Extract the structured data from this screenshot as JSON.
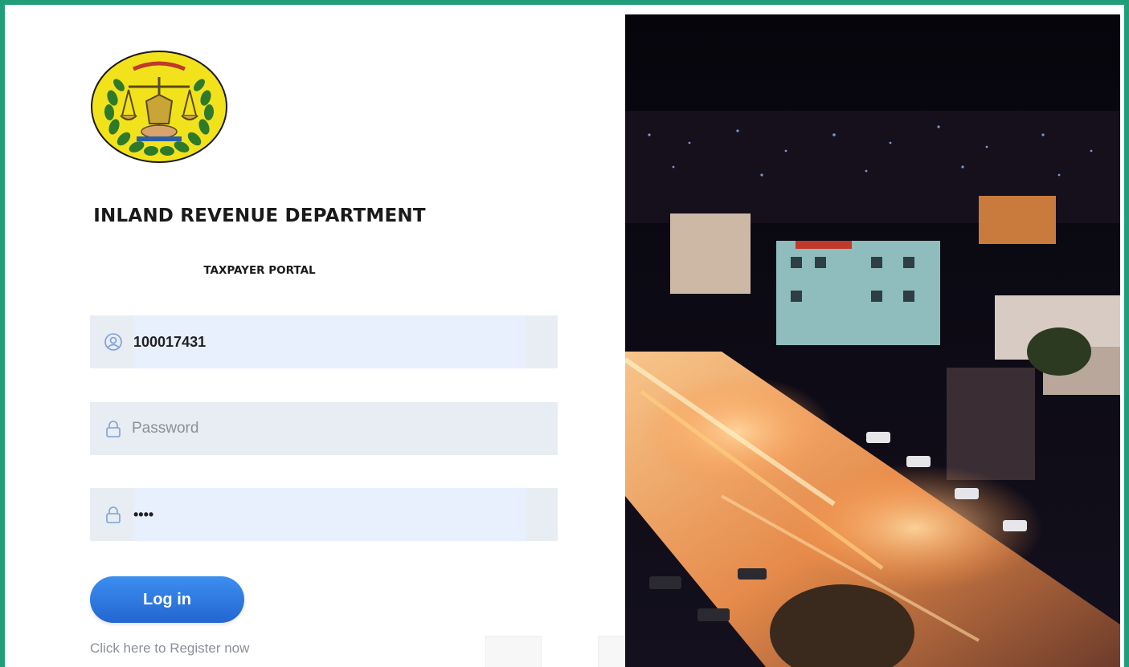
{
  "header": {
    "organization": "INLAND REVENUE DEPARTMENT",
    "portal": "TAXPAYER PORTAL",
    "emblem_icon": "somaliland-coat-of-arms-emblem"
  },
  "form": {
    "username": {
      "value": "100017431",
      "icon": "user-circle-icon"
    },
    "password": {
      "placeholder": "Password",
      "icon": "lock-icon"
    },
    "confirm": {
      "value": "••••",
      "icon": "lock-icon"
    },
    "login_label": "Log in",
    "register_label": "Click here to Register now"
  },
  "hero": {
    "description_icon": "city-night-photo"
  },
  "colors": {
    "frame_border": "#1f9e79",
    "button": "#2e78e0",
    "field_bg": "#e8ecf3",
    "field_autofill": "#e8f0fe"
  }
}
